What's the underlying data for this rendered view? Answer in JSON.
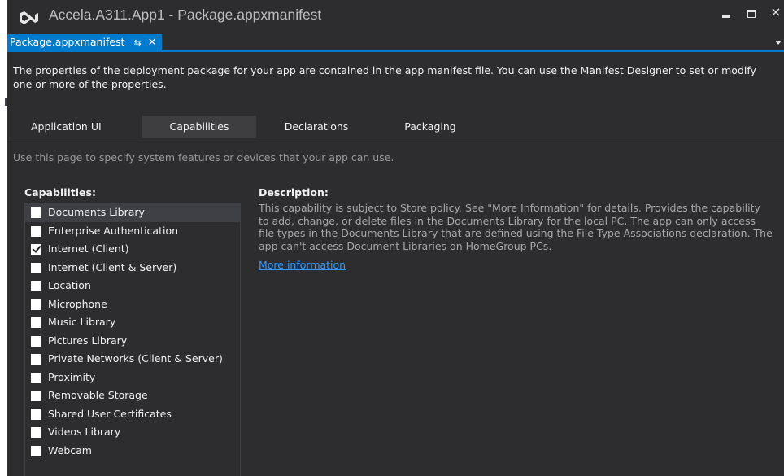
{
  "window": {
    "title": "Accela.A311.App1 - Package.appxmanifest",
    "logo_icon": "visual-studio-logo-icon",
    "controls": {
      "minimize": "minimize-icon",
      "maximize": "maximize-icon",
      "close": "×"
    }
  },
  "doc_tab": {
    "label": "Package.appxmanifest",
    "pin": "⇆",
    "close": "✕"
  },
  "intro_text": "The properties of the deployment package for your app are contained in the app manifest file. You can use the Manifest Designer to set or modify one or more of the properties.",
  "tabs": [
    {
      "label": "Application UI",
      "selected": false
    },
    {
      "label": "Capabilities",
      "selected": true
    },
    {
      "label": "Declarations",
      "selected": false
    },
    {
      "label": "Packaging",
      "selected": false
    }
  ],
  "page_hint": "Use this page to specify system features or devices that your app can use.",
  "capabilities": {
    "heading": "Capabilities:",
    "items": [
      {
        "label": "Documents Library",
        "checked": false,
        "selected": true
      },
      {
        "label": "Enterprise Authentication",
        "checked": false,
        "selected": false
      },
      {
        "label": "Internet (Client)",
        "checked": true,
        "selected": false
      },
      {
        "label": "Internet (Client & Server)",
        "checked": false,
        "selected": false
      },
      {
        "label": "Location",
        "checked": false,
        "selected": false
      },
      {
        "label": "Microphone",
        "checked": false,
        "selected": false
      },
      {
        "label": "Music Library",
        "checked": false,
        "selected": false
      },
      {
        "label": "Pictures Library",
        "checked": false,
        "selected": false
      },
      {
        "label": "Private Networks (Client & Server)",
        "checked": false,
        "selected": false
      },
      {
        "label": "Proximity",
        "checked": false,
        "selected": false
      },
      {
        "label": "Removable Storage",
        "checked": false,
        "selected": false
      },
      {
        "label": "Shared User Certificates",
        "checked": false,
        "selected": false
      },
      {
        "label": "Videos Library",
        "checked": false,
        "selected": false
      },
      {
        "label": "Webcam",
        "checked": false,
        "selected": false
      }
    ]
  },
  "description": {
    "heading": "Description:",
    "text": "This capability is subject to Store policy. See \"More Information\" for details. Provides the capability to add, change, or delete files in the Documents Library for the local PC. The app can only access file types in the Documents Library that are defined using the File Type Associations declaration. The app can't access Document Libraries on HomeGroup PCs.",
    "link": "More information"
  },
  "colors": {
    "background": "#2d2d30",
    "accent": "#007acc",
    "selected_row": "#3f3f46",
    "link": "#3399ff"
  }
}
